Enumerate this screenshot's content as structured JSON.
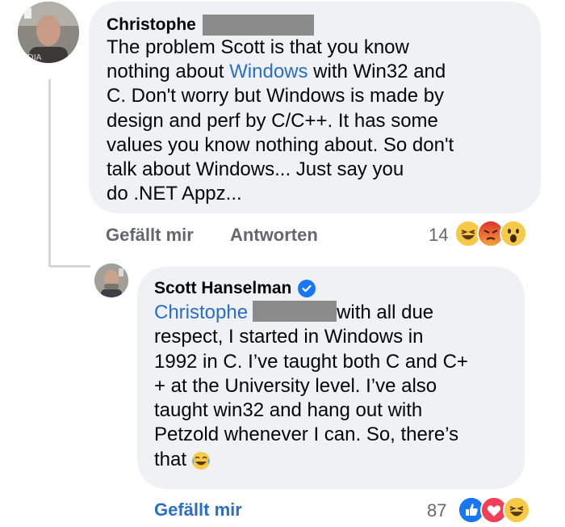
{
  "comment": {
    "author": "Christophe",
    "text_lines": [
      "The problem Scott is that you know",
      "Windows",
      " with Win32 and",
      "C. Don't worry but Windows is made by",
      "design and perf by C/C++. It has some",
      "values you know nothing about. So don't",
      "talk about Windows... Just say you",
      "do .NET Appz..."
    ],
    "line2_prefix": "nothing about ",
    "like_label": "Gefällt mir",
    "reply_label": "Antworten",
    "reaction_count": "14",
    "reactions": [
      "haha-icon",
      "angry-icon",
      "wow-icon"
    ]
  },
  "reply": {
    "author": "Scott Hanselman",
    "mention": "Christophe",
    "line1_rest": "with all due",
    "text_lines": [
      "respect, I started in Windows in",
      "1992 in C. I’ve taught both C and C+",
      "+ at the University level. I’ve also",
      "taught win32 and hang out with",
      "Petzold whenever I can. So, there’s",
      "that"
    ],
    "like_label": "Gefällt mir",
    "reaction_count": "87",
    "reactions": [
      "like-icon",
      "love-icon",
      "haha-icon"
    ]
  },
  "colors": {
    "bubble": "#eff1f4",
    "link": "#2a6ec6",
    "muted": "#65676b",
    "redaction": "#8b8b8b"
  }
}
